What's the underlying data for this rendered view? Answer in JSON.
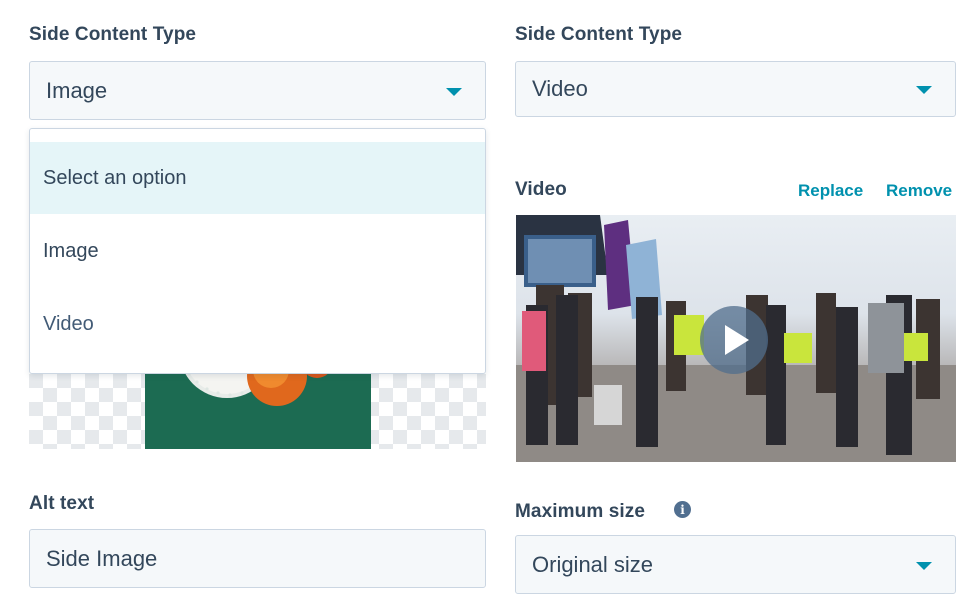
{
  "left": {
    "content_type_label": "Side Content Type",
    "content_type_value": "Image",
    "dropdown_options": [
      "Select an option",
      "Image",
      "Video"
    ],
    "alt_text_label": "Alt text",
    "alt_text_value": "Side Image"
  },
  "right": {
    "content_type_label": "Side Content Type",
    "content_type_value": "Video",
    "video_label": "Video",
    "replace_label": "Replace",
    "remove_label": "Remove",
    "max_size_label": "Maximum size",
    "max_size_value": "Original size"
  },
  "colors": {
    "accent": "#0091ae",
    "text": "#33475b",
    "field_bg": "#f5f8fa",
    "border": "#cbd6e2",
    "highlight": "#e5f5f8"
  }
}
